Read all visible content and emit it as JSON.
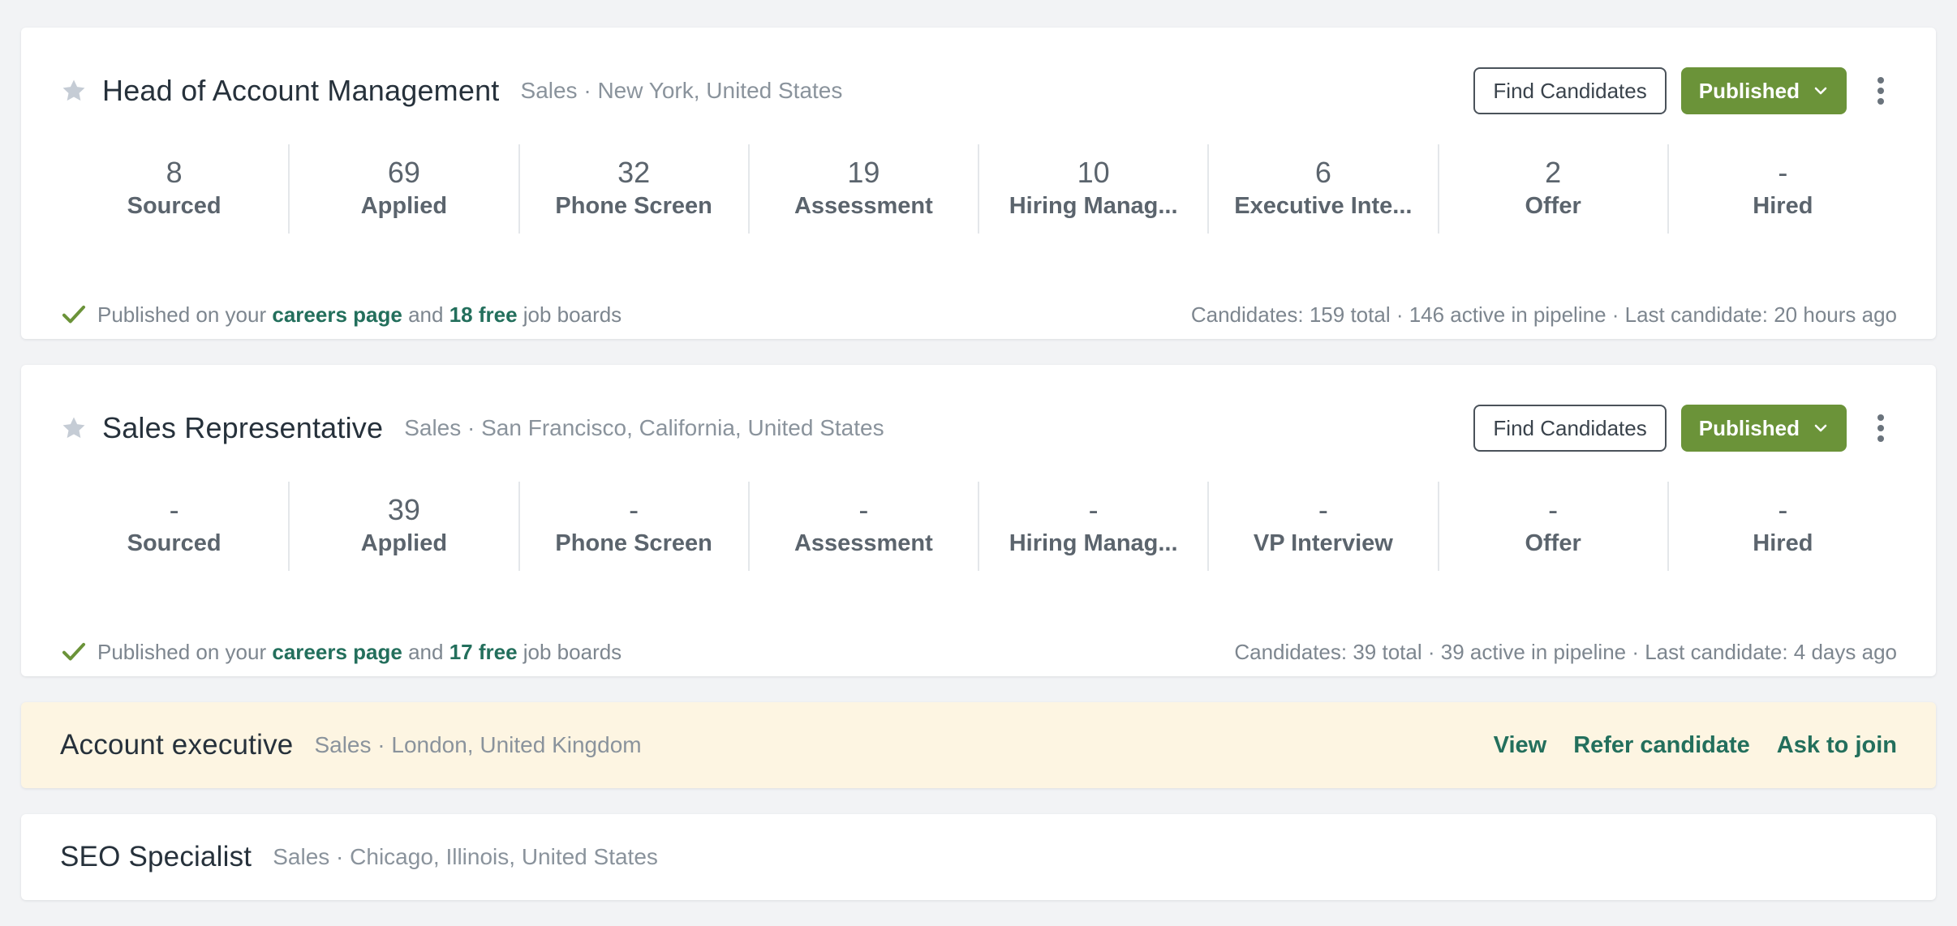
{
  "jobs": [
    {
      "title": "Head of Account Management",
      "meta": "Sales · New York, United States",
      "find_label": "Find Candidates",
      "status_label": "Published",
      "stages": [
        {
          "count": "8",
          "label": "Sourced"
        },
        {
          "count": "69",
          "label": "Applied"
        },
        {
          "count": "32",
          "label": "Phone Screen"
        },
        {
          "count": "19",
          "label": "Assessment"
        },
        {
          "count": "10",
          "label": "Hiring Manag..."
        },
        {
          "count": "6",
          "label": "Executive Inte..."
        },
        {
          "count": "2",
          "label": "Offer"
        },
        {
          "count": "-",
          "label": "Hired"
        }
      ],
      "footer": {
        "prefix": "Published on your",
        "careers_link": "careers page",
        "and": "and",
        "boards_link": "18 free",
        "suffix": "job boards",
        "summary": "Candidates: 159 total · 146 active in pipeline · Last candidate: 20 hours ago"
      }
    },
    {
      "title": "Sales Representative",
      "meta": "Sales · San Francisco, California, United States",
      "find_label": "Find Candidates",
      "status_label": "Published",
      "stages": [
        {
          "count": "-",
          "label": "Sourced"
        },
        {
          "count": "39",
          "label": "Applied"
        },
        {
          "count": "-",
          "label": "Phone Screen"
        },
        {
          "count": "-",
          "label": "Assessment"
        },
        {
          "count": "-",
          "label": "Hiring Manag..."
        },
        {
          "count": "-",
          "label": "VP Interview"
        },
        {
          "count": "-",
          "label": "Offer"
        },
        {
          "count": "-",
          "label": "Hired"
        }
      ],
      "footer": {
        "prefix": "Published on your",
        "careers_link": "careers page",
        "and": "and",
        "boards_link": "17 free",
        "suffix": "job boards",
        "summary": "Candidates: 39 total · 39 active in pipeline · Last candidate: 4 days ago"
      }
    }
  ],
  "restricted_job": {
    "title": "Account executive",
    "meta": "Sales · London, United Kingdom",
    "view_label": "View",
    "refer_label": "Refer candidate",
    "join_label": "Ask to join"
  },
  "other_job": {
    "title": "SEO Specialist",
    "meta": "Sales · Chicago, Illinois, United States"
  },
  "icons": {
    "star": "star-icon",
    "check": "check-icon",
    "chevron": "chevron-down-icon",
    "more": "more-vertical-icon"
  },
  "colors": {
    "background": "#f2f3f5",
    "primary_button": "#6b9339",
    "link": "#236f5c",
    "check": "#6b9339",
    "star": "#c5ccd5",
    "restricted_background": "#fdf5e2"
  }
}
